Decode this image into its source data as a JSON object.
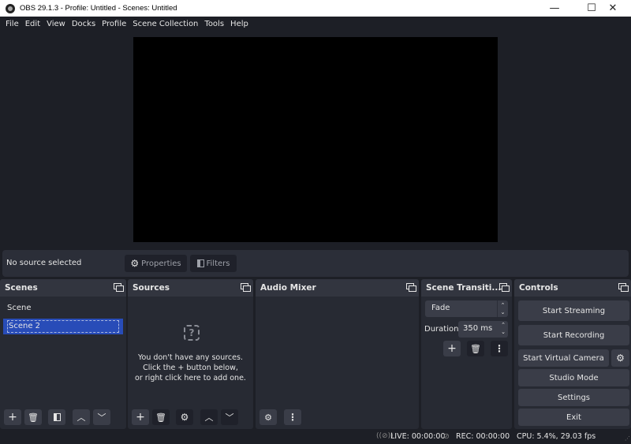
{
  "window": {
    "title": "OBS 29.1.3 - Profile: Untitled - Scenes: Untitled",
    "minimize": "—",
    "maximize": "☐",
    "close": "✕"
  },
  "menu": [
    "File",
    "Edit",
    "View",
    "Docks",
    "Profile",
    "Scene Collection",
    "Tools",
    "Help"
  ],
  "context_bar": {
    "status": "No source selected",
    "properties": "Properties",
    "filters": "Filters"
  },
  "scenes": {
    "title": "Scenes",
    "items": [
      {
        "label": "Scene",
        "selected": false
      },
      {
        "label": "Scene 2",
        "selected": true
      }
    ]
  },
  "sources": {
    "title": "Sources",
    "empty_line1": "You don't have any sources.",
    "empty_line2": "Click the + button below,",
    "empty_line3": "or right click here to add one."
  },
  "audio_mixer": {
    "title": "Audio Mixer"
  },
  "scene_transitions": {
    "title": "Scene Transiti...",
    "transition": "Fade",
    "duration_label": "Duration",
    "duration_value": "350 ms"
  },
  "controls": {
    "title": "Controls",
    "start_streaming": "Start Streaming",
    "start_recording": "Start Recording",
    "start_virtual_camera": "Start Virtual Camera",
    "studio_mode": "Studio Mode",
    "settings": "Settings",
    "exit": "Exit"
  },
  "status": {
    "live": "LIVE: 00:00:00",
    "rec": "REC: 00:00:00",
    "cpu": "CPU: 5.4%, 29.03 fps"
  }
}
